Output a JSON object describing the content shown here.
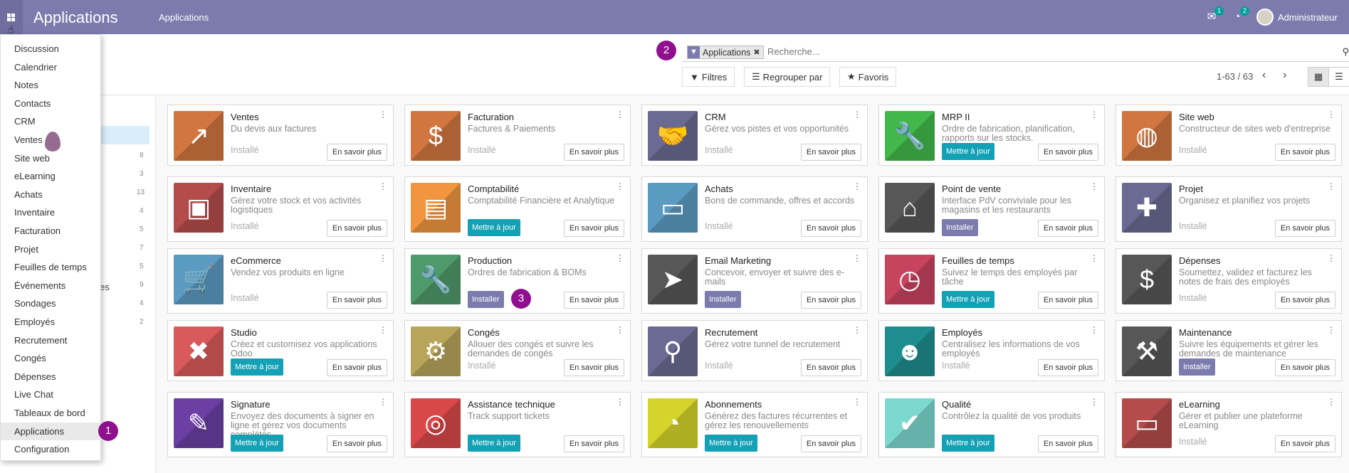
{
  "navbar": {
    "brand": "Applications",
    "menu_link": "Applications",
    "messages_count": "1",
    "activities_count": "2",
    "user_name": "Administrateur"
  },
  "steps": {
    "menu": "1",
    "search": "2",
    "install": "3"
  },
  "search": {
    "facet_label": "Applications",
    "placeholder": "Recherche..."
  },
  "controls": {
    "filters": "Filtres",
    "group_by": "Regrouper par",
    "favorites": "Favoris",
    "pager": "1-63 / 63"
  },
  "side_counts": [
    "8",
    "3",
    "13",
    "4",
    "5",
    "7",
    "5",
    "9",
    "4",
    "2"
  ],
  "side_fragment": "es",
  "menu_items": [
    "Discussion",
    "Calendrier",
    "Notes",
    "Contacts",
    "CRM",
    "Ventes",
    "Site web",
    "eLearning",
    "Achats",
    "Inventaire",
    "Facturation",
    "Projet",
    "Feuilles de temps",
    "Événements",
    "Sondages",
    "Employés",
    "Recrutement",
    "Congés",
    "Dépenses",
    "Live Chat",
    "Tableaux de bord",
    "Applications",
    "Configuration"
  ],
  "active_menu": "Applications",
  "labels": {
    "installed": "Installé",
    "learn_more": "En savoir plus",
    "update": "Mettre à jour",
    "install": "Installer"
  },
  "apps": [
    {
      "name": "Ventes",
      "summary": "Du devis aux factures",
      "state": "installed",
      "color": "#d2763f",
      "icon": "chart-up-icon"
    },
    {
      "name": "Facturation",
      "summary": "Factures & Paiements",
      "state": "installed",
      "color": "#d2763f",
      "icon": "invoice-icon"
    },
    {
      "name": "CRM",
      "summary": "Gérez vos pistes et vos opportunités",
      "state": "installed",
      "color": "#6a6a93",
      "icon": "handshake-icon"
    },
    {
      "name": "MRP II",
      "summary": "Ordre de fabrication, planification, rapports sur les stocks.",
      "state": "update",
      "color": "#43b84a",
      "icon": "wrench-icon"
    },
    {
      "name": "Site web",
      "summary": "Constructeur de sites web d'entreprise",
      "state": "installed",
      "color": "#d2763f",
      "icon": "globe-icon"
    },
    {
      "name": "Inventaire",
      "summary": "Gérez votre stock et vos activités logistiques",
      "state": "installed",
      "color": "#b44c4c",
      "icon": "box-icon"
    },
    {
      "name": "Comptabilité",
      "summary": "Comptabilité Financière et Analytique",
      "state": "update",
      "color": "#f1963f",
      "icon": "document-icon"
    },
    {
      "name": "Achats",
      "summary": "Bons de commande, offres et accords",
      "state": "installed",
      "color": "#5b9bc2",
      "icon": "credit-card-icon"
    },
    {
      "name": "Point de vente",
      "summary": "Interface PdV conviviale pour les magasins et les restaurants",
      "state": "install",
      "color": "#575757",
      "icon": "shop-icon"
    },
    {
      "name": "Projet",
      "summary": "Organisez et planifiez vos projets",
      "state": "installed",
      "color": "#6a6a93",
      "icon": "puzzle-icon"
    },
    {
      "name": "eCommerce",
      "summary": "Vendez vos produits en ligne",
      "state": "installed",
      "color": "#5b9bc2",
      "icon": "cart-icon"
    },
    {
      "name": "Production",
      "summary": "Ordres de fabrication & BOMs",
      "state": "install",
      "color": "#4f9a6b",
      "icon": "wrench-icon"
    },
    {
      "name": "Email Marketing",
      "summary": "Concevoir, envoyer et suivre des e-mails",
      "state": "install",
      "color": "#575757",
      "icon": "paper-plane-icon"
    },
    {
      "name": "Feuilles de temps",
      "summary": "Suivez le temps des employés par tâche",
      "state": "update",
      "color": "#c8435e",
      "icon": "clock-icon"
    },
    {
      "name": "Dépenses",
      "summary": "Soumettez, validez et facturez les notes de frais des employés",
      "state": "installed",
      "color": "#575757",
      "icon": "user-dollar-icon"
    },
    {
      "name": "Studio",
      "summary": "Créez et customisez vos applications Odoo",
      "state": "update",
      "color": "#d95a5a",
      "icon": "tools-icon"
    },
    {
      "name": "Congés",
      "summary": "Allouer des congés et suivre les demandes de congés",
      "state": "installed",
      "color": "#b8a55a",
      "icon": "user-gear-icon"
    },
    {
      "name": "Recrutement",
      "summary": "Gérez votre tunnel de recrutement",
      "state": "installed",
      "color": "#6a6a93",
      "icon": "magnifier-icon"
    },
    {
      "name": "Employés",
      "summary": "Centralisez les informations de vos employés",
      "state": "installed",
      "color": "#1e8d8f",
      "icon": "users-icon"
    },
    {
      "name": "Maintenance",
      "summary": "Suivre les équipements et gérer les demandes de maintenance",
      "state": "install",
      "color": "#575757",
      "icon": "hammer-icon"
    },
    {
      "name": "Signature",
      "summary": "Envoyez des documents à signer en ligne et gérez vos documents complétés",
      "state": "update",
      "color": "#6b3fa4",
      "icon": "signature-icon"
    },
    {
      "name": "Assistance technique",
      "summary": "Track support tickets",
      "state": "update",
      "color": "#d94848",
      "icon": "lifebuoy-icon"
    },
    {
      "name": "Abonnements",
      "summary": "Générez des factures récurrentes et gérez les renouvellements",
      "state": "update",
      "color": "#d4d42a",
      "icon": "rss-icon"
    },
    {
      "name": "Qualité",
      "summary": "Contrôlez la qualité de vos produits",
      "state": "update",
      "color": "#7cd9cf",
      "icon": "quality-check-icon"
    },
    {
      "name": "eLearning",
      "summary": "Gérer et publier une plateforme eLearning",
      "state": "installed",
      "color": "#b44c4c",
      "icon": "presentation-icon"
    }
  ]
}
